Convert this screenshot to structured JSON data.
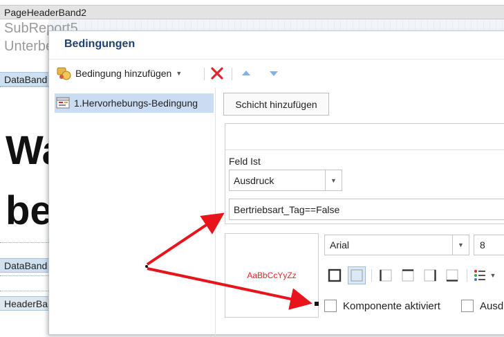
{
  "designer": {
    "page_header_band": "PageHeaderBand2",
    "subreport": "SubReport5",
    "unter_text": "Unterbe",
    "data_band_1": "DataBand",
    "data_band_2": "DataBand",
    "header_band": "HeaderBand",
    "big_text_1": "Wa",
    "big_text_2": "be"
  },
  "dialog": {
    "title": "Bedingungen",
    "toolbar": {
      "add_condition_label": "Bedingung hinzufügen"
    },
    "conditions": [
      {
        "label": "1.Hervorhebungs-Bedingung"
      }
    ],
    "add_layer_label": "Schicht hinzufügen",
    "field_label": "Feld Ist",
    "field_value": "Ausdruck",
    "expression": "Bertriebsart_Tag==False",
    "preview_text": "AaBbCcYyZz",
    "preview_color": "#e0262a",
    "font_name": "Arial",
    "font_size": "8",
    "component_enabled_label": "Komponente aktiviert",
    "component_enabled": false,
    "other_check_label": "Ausd",
    "other_check": false
  },
  "colors": {
    "title": "#20416e",
    "selection": "#c9dcf2",
    "arrow": "#e8141b"
  }
}
